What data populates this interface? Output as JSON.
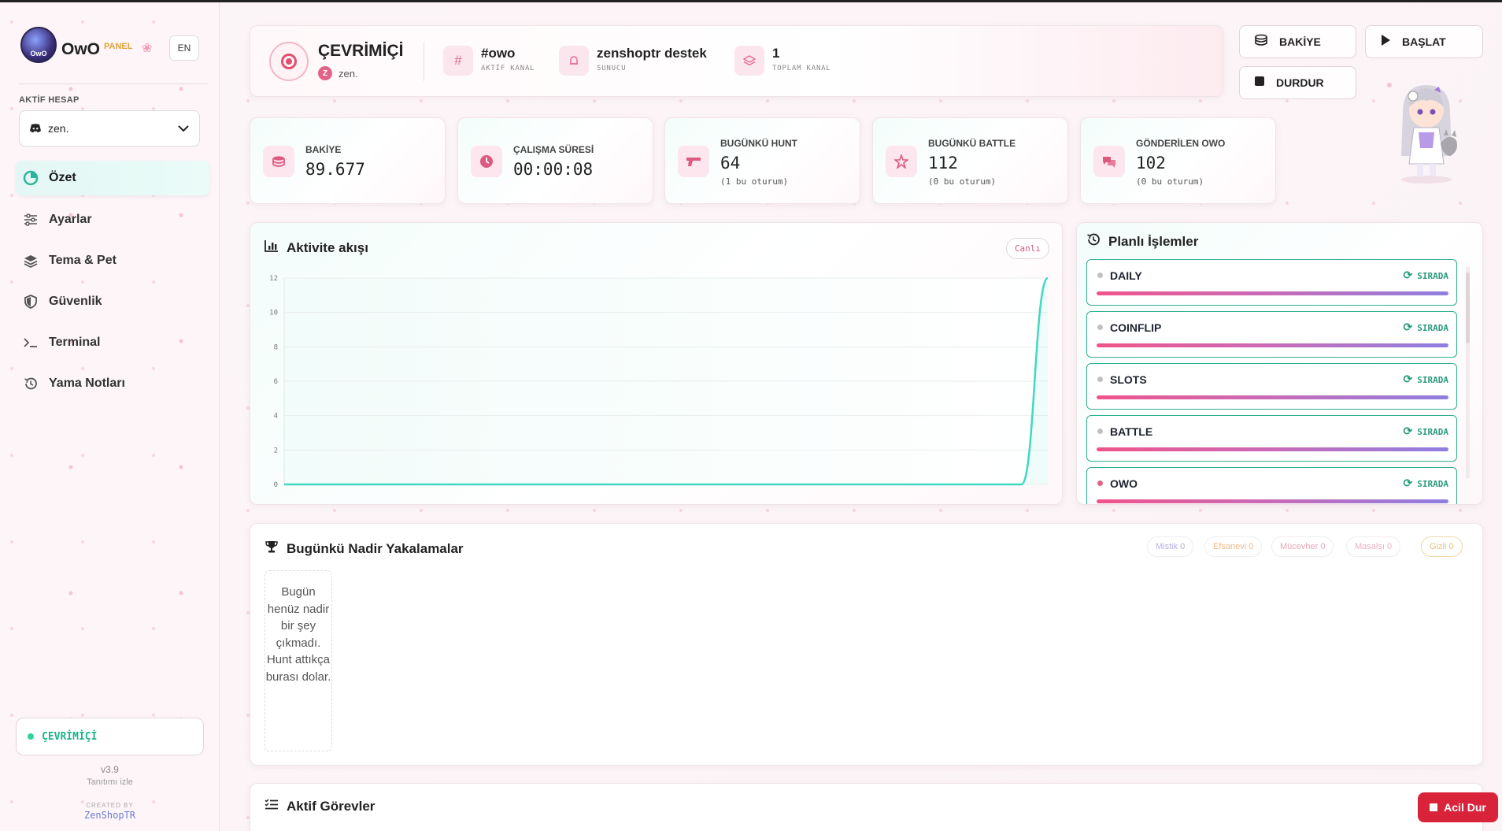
{
  "sidebar": {
    "brand": "OwO",
    "brand_sub": "PANEL",
    "logo_text": "OwO",
    "lang_button": "EN",
    "account_label": "AKTİF HESAP",
    "account_value": "zen.",
    "nav": [
      {
        "label": "Özet",
        "icon": "pie-chart-icon",
        "active": true
      },
      {
        "label": "Ayarlar",
        "icon": "sliders-icon"
      },
      {
        "label": "Tema & Pet",
        "icon": "layers-icon"
      },
      {
        "label": "Güvenlik",
        "icon": "shield-icon"
      },
      {
        "label": "Terminal",
        "icon": "terminal-icon"
      },
      {
        "label": "Yama Notları",
        "icon": "history-icon"
      }
    ],
    "status": "ÇEVRİMİÇİ",
    "version": "v3.9",
    "tour_link": "Tanıtımı izle",
    "created_by": "CREATED BY",
    "creator": "ZenShopTR"
  },
  "statusbar": {
    "title": "ÇEVRİMİÇİ",
    "user_initial": "Z",
    "user": "zen.",
    "channel_value": "#owo",
    "channel_label": "AKTİF KANAL",
    "server_value": "zenshoptr destek",
    "server_label": "SUNUCU",
    "total_value": "1",
    "total_label": "TOPLAM KANAL"
  },
  "actions": {
    "balance": "BAKİYE",
    "start": "BAŞLAT",
    "stop": "DURDUR"
  },
  "stats": [
    {
      "label": "BAKİYE",
      "value": "89.677",
      "sub": "",
      "icon": "coins-icon"
    },
    {
      "label": "ÇALIŞMA SÜRESİ",
      "value": "00:00:08",
      "sub": "",
      "icon": "clock-icon"
    },
    {
      "label": "BUGÜNKÜ HUNT",
      "value": "64",
      "sub": "(1 bu oturum)",
      "icon": "gun-icon"
    },
    {
      "label": "BUGÜNKÜ BATTLE",
      "value": "112",
      "sub": "(0 bu oturum)",
      "icon": "battle-icon"
    },
    {
      "label": "GÖNDERİLEN OWO",
      "value": "102",
      "sub": "(0 bu oturum)",
      "icon": "chat-icon"
    }
  ],
  "activity": {
    "title": "Aktivite akışı",
    "live_badge": "Canlı"
  },
  "chart_data": {
    "type": "area",
    "title": "Aktivite akışı",
    "xlabel": "",
    "ylabel": "",
    "ylim": [
      0,
      12
    ],
    "yticks": [
      "0",
      "2",
      "4",
      "6",
      "8",
      "10",
      "12"
    ],
    "x": [
      0,
      1,
      2,
      3,
      4,
      5,
      6,
      7,
      8,
      9,
      10,
      11,
      12,
      13,
      14,
      15,
      16,
      17,
      18,
      19,
      20,
      21,
      22,
      23,
      24,
      25,
      26,
      27,
      28,
      29
    ],
    "series": [
      {
        "values": [
          0,
          0,
          0,
          0,
          0,
          0,
          0,
          0,
          0,
          0,
          0,
          0,
          0,
          0,
          0,
          0,
          0,
          0,
          0,
          0,
          0,
          0,
          0,
          0,
          0,
          0,
          0,
          0,
          0,
          12
        ]
      }
    ],
    "grid": true,
    "color": "#3fd9bf"
  },
  "scheduled": {
    "title": "Planlı İşlemler",
    "items": [
      {
        "name": "DAILY",
        "status": "SIRADA"
      },
      {
        "name": "COINFLIP",
        "status": "SIRADA"
      },
      {
        "name": "SLOTS",
        "status": "SIRADA"
      },
      {
        "name": "BATTLE",
        "status": "SIRADA"
      },
      {
        "name": "OWO",
        "status": "SIRADA"
      }
    ]
  },
  "rare": {
    "title": "Bugünkü Nadir Yakalamalar",
    "badges": [
      {
        "label": "Mistik",
        "count": "0",
        "color": "#b7b0e6"
      },
      {
        "label": "Efsanevi",
        "count": "0",
        "color": "#f1b98a"
      },
      {
        "label": "Mücevher",
        "count": "0",
        "color": "#e8a7b8"
      },
      {
        "label": "Masalsı",
        "count": "0",
        "color": "#eab1c3"
      },
      {
        "label": "Gizli",
        "count": "0",
        "color": "#e8c27a"
      }
    ],
    "empty_text": "Bugün henüz nadir bir şey çıkmadı. Hunt attıkça burası dolar."
  },
  "tasks": {
    "title": "Aktif Görevler"
  },
  "emergency": "Acil Dur"
}
